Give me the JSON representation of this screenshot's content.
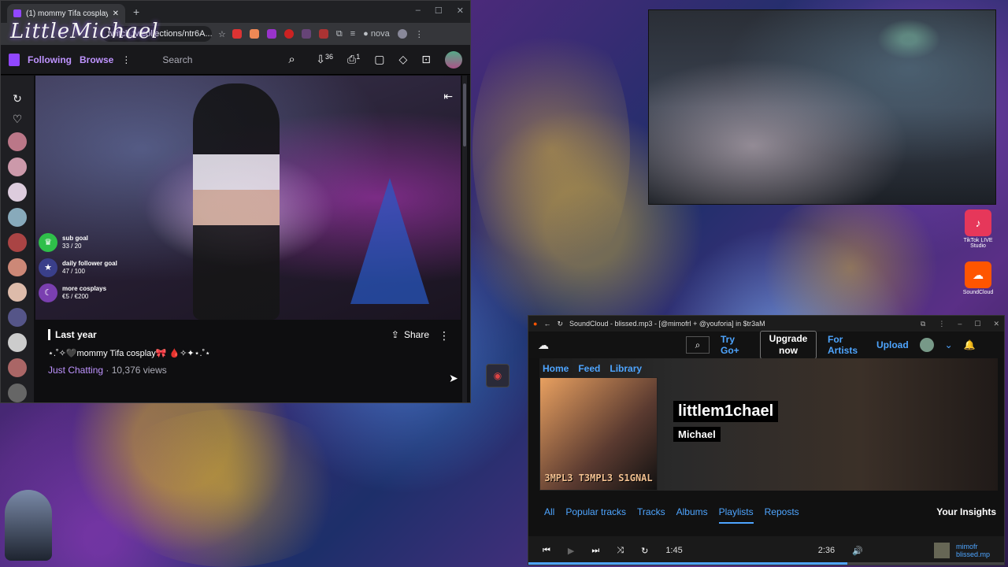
{
  "browser": {
    "tab_title": "(1) mommy Tifa cosplay",
    "url": "twitch.tv/collections/ntr6A...",
    "logo_overlay": "LittleMichael",
    "extensions_label": "nova",
    "badge_36": "36",
    "badge_1": "1",
    "nav": {
      "following": "Following",
      "browse": "Browse",
      "search_placeholder": "Search"
    },
    "video": {
      "goals": [
        {
          "label": "sub goal",
          "value": "33 / 20"
        },
        {
          "label": "daily follower goal",
          "value": "47 / 100"
        },
        {
          "label": "more cosplays",
          "value": "€5 / €200"
        }
      ]
    },
    "info": {
      "date": "Last year",
      "title": "⋆.˚✧🖤mommy Tifa cosplay🎀 🩸✧✦⋆.˚⋆",
      "category": "Just Chatting",
      "views": " · 10,376 views",
      "share": "Share"
    }
  },
  "desktop": {
    "tiktok_label": "TikTok LIVE Studio",
    "soundcloud_label": "SoundCloud"
  },
  "soundcloud": {
    "window_title": "SoundCloud - blissed.mp3 - [@mimofrl + @youforia] in $tr3aM",
    "nav": {
      "try_go": "Try Go+",
      "upgrade": "Upgrade now",
      "for_artists": "For Artists",
      "upload": "Upload"
    },
    "home_tabs": [
      "Home",
      "Feed",
      "Library"
    ],
    "art_text": "3MPL3 T3MPL3 S1GNAL",
    "username": "littlem1chael",
    "realname": "Michael",
    "tabs": [
      "All",
      "Popular tracks",
      "Tracks",
      "Albums",
      "Playlists",
      "Reposts"
    ],
    "insights": "Your Insights",
    "player": {
      "elapsed": "1:45",
      "duration": "2:36",
      "track_artist": "mimofr",
      "track_title": "blissed.mp",
      "progress_fraction": 0.67
    }
  },
  "colors": {
    "twitch_purple": "#9147ff",
    "twitch_link": "#bf94ff",
    "soundcloud_link": "#4ea5ff"
  }
}
